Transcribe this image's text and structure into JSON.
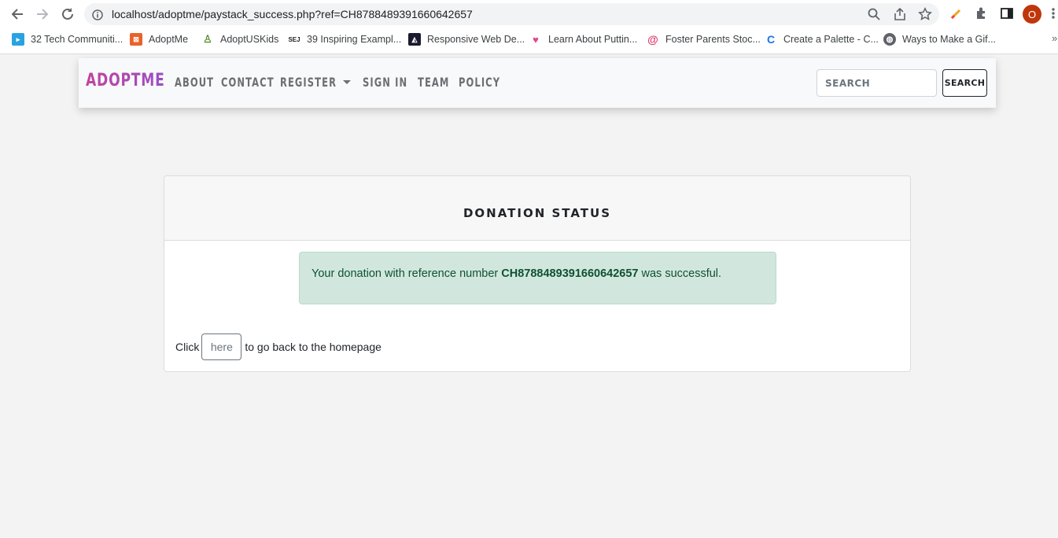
{
  "browser": {
    "url": "localhost/adoptme/paystack_success.php?ref=CH8788489391660642657",
    "profile_initial": "O",
    "bookmarks": [
      {
        "label": "32 Tech Communiti...",
        "color": "#29a3e0"
      },
      {
        "label": "AdoptMe",
        "color": "#e8632b"
      },
      {
        "label": "AdoptUSKids",
        "color": "#5a8f3c"
      },
      {
        "label": "39 Inspiring Exampl...",
        "color": "#222222"
      },
      {
        "label": "Responsive Web De...",
        "color": "#1b1b2f"
      },
      {
        "label": "Learn About Puttin...",
        "color": "#e0478d"
      },
      {
        "label": "Foster Parents Stoc...",
        "color": "#e23c6b"
      },
      {
        "label": "Create a Palette - C...",
        "color": "#1a73e8"
      },
      {
        "label": "Ways to Make a Gif...",
        "color": "#5f6368"
      }
    ],
    "more_label": "»"
  },
  "site_nav": {
    "brand": "ADOPTME",
    "links": {
      "about": "ABOUT",
      "contact": "CONTACT",
      "register": "REGISTER",
      "sign_in": "SIGN IN",
      "team": "TEAM",
      "policy": "POLICY"
    },
    "search_placeholder": "SEARCH",
    "search_button": "SEARCH"
  },
  "card": {
    "title": "DONATION STATUS",
    "alert_prefix": "Your donation with reference number",
    "reference": "CH8788489391660642657",
    "alert_suffix": "was successful.",
    "click_prefix": "Click",
    "here_button": "here",
    "click_suffix": "to go back to the homepage"
  }
}
